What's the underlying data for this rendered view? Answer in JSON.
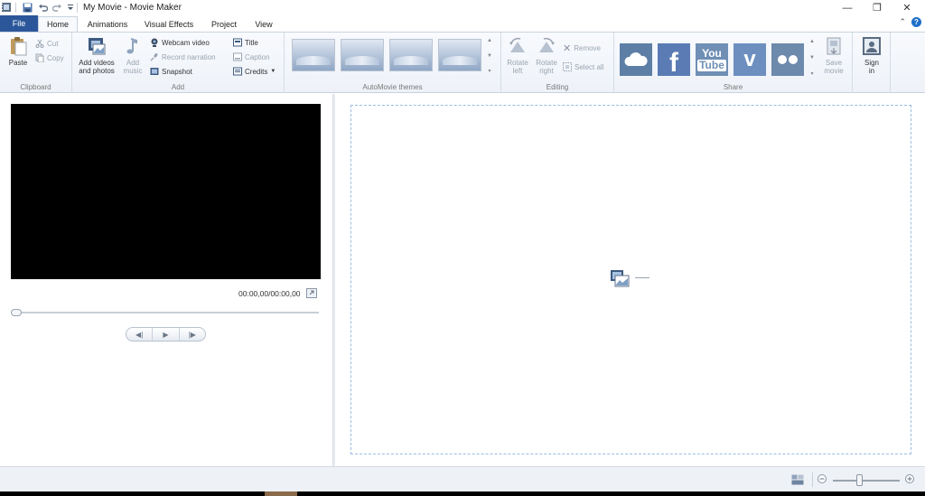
{
  "window": {
    "title": "My Movie - Movie Maker",
    "minimize_glyph": "—",
    "restore_glyph": "❐",
    "close_glyph": "✕"
  },
  "quick_access": {
    "app_icon": "movie-maker-icon",
    "save_icon": "save-icon",
    "undo_icon": "undo-icon",
    "redo_icon": "redo-icon",
    "customize_icon": "dropdown-arrow-icon"
  },
  "tabs": [
    "File",
    "Home",
    "Animations",
    "Visual Effects",
    "Project",
    "View"
  ],
  "help": {
    "collapse_glyph": "⌃",
    "help_glyph": "?"
  },
  "ribbon": {
    "clipboard": {
      "label": "Clipboard",
      "paste": "Paste",
      "cut": "Cut",
      "copy": "Copy"
    },
    "add": {
      "label": "Add",
      "add_videos_line1": "Add videos",
      "add_videos_line2": "and photos",
      "add_music_line1": "Add",
      "add_music_line2": "music",
      "webcam": "Webcam video",
      "record_narration": "Record narration",
      "snapshot": "Snapshot",
      "title": "Title",
      "caption": "Caption",
      "credits": "Credits"
    },
    "themes": {
      "label": "AutoMovie themes"
    },
    "editing": {
      "label": "Editing",
      "rotate_left_line1": "Rotate",
      "rotate_left_line2": "left",
      "rotate_right_line1": "Rotate",
      "rotate_right_line2": "right",
      "remove": "Remove",
      "select_all": "Select all"
    },
    "share": {
      "label": "Share",
      "youtube_line1": "You",
      "youtube_line2": "Tube",
      "save_movie_line1": "Save",
      "save_movie_line2": "movie",
      "sign_in_line1": "Sign",
      "sign_in_line2": "in"
    }
  },
  "player": {
    "time": "00:00,00/00:00,00",
    "prev_glyph": "◀|",
    "play_glyph": "▶",
    "next_glyph": "|▶"
  },
  "colors": {
    "file_tab": "#2b579a",
    "onedrive": "#5d7fa6",
    "facebook": "#5b7bb4",
    "youtube": "#6f8fb5",
    "vimeo": "#6c8fc0",
    "flickr": "#6d89ab"
  }
}
